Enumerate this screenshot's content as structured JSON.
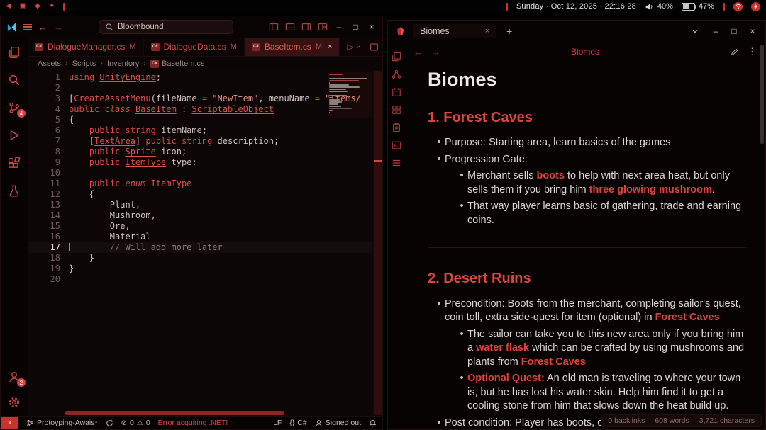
{
  "ui": {
    "bullet": "•",
    "crumb_sep": "›",
    "minimize": "–",
    "maximize": "□",
    "close": "×",
    "plus": "+",
    "back": "←",
    "forward": "→",
    "run": "▷",
    "more_h": "⋯",
    "more_v": "⋮",
    "braces": "{}",
    "err_glyph": "⊘",
    "warn_glyph": "⚠",
    "cs_badge": "C#",
    "tray_glyph": "◈"
  },
  "topbar": {
    "left_icons": [
      {
        "name": "nav-left-icon",
        "glyph": "◀"
      },
      {
        "name": "workspace-icon",
        "glyph": "▣"
      },
      {
        "name": "modules-icon",
        "glyph": "◆"
      },
      {
        "name": "sparkle-icon",
        "glyph": "✦"
      }
    ],
    "clock": "Sunday · Oct 12, 2025 · 22:16:28",
    "volume": "40%",
    "battery": "47%"
  },
  "vscode": {
    "search_value": "Bloombound",
    "activity": {
      "scm_badge": "4",
      "accounts_badge": "2"
    },
    "tabs": [
      {
        "label": "DialogueManager.cs",
        "badge": "M"
      },
      {
        "label": "DialogueData.cs",
        "badge": "M"
      },
      {
        "label": "BaseItem.cs",
        "badge": "M"
      }
    ],
    "breadcrumbs": [
      "Assets",
      "Scripts",
      "Inventory",
      "BaseItem.cs"
    ],
    "code": {
      "lines": [
        {
          "n": "1",
          "tk": [
            {
              "t": "using ",
              "c": "k"
            },
            {
              "t": "UnityEngine",
              "c": "tu"
            },
            {
              "t": ";",
              "c": "p"
            }
          ]
        },
        {
          "n": "2",
          "tk": []
        },
        {
          "n": "3",
          "tk": [
            {
              "t": "[",
              "c": "p"
            },
            {
              "t": "CreateAssetMenu",
              "c": "tu"
            },
            {
              "t": "(fileName ",
              "c": "p"
            },
            {
              "t": "= ",
              "c": "o"
            },
            {
              "t": "\"NewItem\"",
              "c": "s"
            },
            {
              "t": ", menuName ",
              "c": "p"
            },
            {
              "t": "= ",
              "c": "o"
            },
            {
              "t": "\"Items/",
              "c": "s"
            }
          ]
        },
        {
          "n": "4",
          "tk": [
            {
              "t": "public ",
              "c": "k"
            },
            {
              "t": "class ",
              "c": "ki"
            },
            {
              "t": "BaseItem",
              "c": "tu"
            },
            {
              "t": " : ",
              "c": "p"
            },
            {
              "t": "ScriptableObject",
              "c": "tu"
            }
          ]
        },
        {
          "n": "5",
          "tk": [
            {
              "t": "{",
              "c": "p"
            }
          ]
        },
        {
          "n": "6",
          "tk": [
            {
              "t": "    ",
              "c": "p"
            },
            {
              "t": "public string ",
              "c": "k"
            },
            {
              "t": "itemName;",
              "c": "p"
            }
          ]
        },
        {
          "n": "7",
          "tk": [
            {
              "t": "    [",
              "c": "p"
            },
            {
              "t": "TextArea",
              "c": "tu"
            },
            {
              "t": "] ",
              "c": "p"
            },
            {
              "t": "public string ",
              "c": "k"
            },
            {
              "t": "description;",
              "c": "p"
            }
          ]
        },
        {
          "n": "8",
          "tk": [
            {
              "t": "    ",
              "c": "p"
            },
            {
              "t": "public ",
              "c": "k"
            },
            {
              "t": "Sprite",
              "c": "tu"
            },
            {
              "t": " icon;",
              "c": "p"
            }
          ]
        },
        {
          "n": "9",
          "tk": [
            {
              "t": "    ",
              "c": "p"
            },
            {
              "t": "public ",
              "c": "k"
            },
            {
              "t": "ItemType",
              "c": "tu"
            },
            {
              "t": " type;",
              "c": "p"
            }
          ]
        },
        {
          "n": "10",
          "tk": []
        },
        {
          "n": "11",
          "tk": [
            {
              "t": "    ",
              "c": "p"
            },
            {
              "t": "public ",
              "c": "k"
            },
            {
              "t": "enum ",
              "c": "ki"
            },
            {
              "t": "ItemType",
              "c": "tu"
            }
          ]
        },
        {
          "n": "12",
          "tk": [
            {
              "t": "    {",
              "c": "p"
            }
          ]
        },
        {
          "n": "13",
          "tk": [
            {
              "t": "        Plant,",
              "c": "p"
            }
          ]
        },
        {
          "n": "14",
          "tk": [
            {
              "t": "        Mushroom,",
              "c": "p"
            }
          ]
        },
        {
          "n": "15",
          "tk": [
            {
              "t": "        Ore,",
              "c": "p"
            }
          ]
        },
        {
          "n": "16",
          "tk": [
            {
              "t": "        Material",
              "c": "p"
            }
          ]
        },
        {
          "n": "17",
          "cur": true,
          "caret": true,
          "tk": [
            {
              "t": "        // Will add more later",
              "c": "c"
            }
          ]
        },
        {
          "n": "18",
          "tk": [
            {
              "t": "    }",
              "c": "p"
            }
          ]
        },
        {
          "n": "19",
          "tk": [
            {
              "t": "}",
              "c": "p"
            }
          ]
        },
        {
          "n": "20",
          "tk": []
        }
      ]
    },
    "statusbar": {
      "branch": "Protoyping-Awais*",
      "errors": "0",
      "warnings": "0",
      "notice": "Error acquiring .NET!",
      "eol": "LF",
      "language": "C#",
      "account": "Signed out"
    }
  },
  "obsidian": {
    "tab_title": "Biomes",
    "path_title": "Biomes",
    "doc_title": "Biomes",
    "sections": [
      {
        "heading": "1. Forest Caves",
        "items": [
          {
            "level": 1,
            "segments": [
              {
                "t": "Purpose: Starting area, learn basics of the games"
              }
            ]
          },
          {
            "level": 1,
            "segments": [
              {
                "t": "Progression Gate:"
              }
            ]
          },
          {
            "level": 2,
            "segments": [
              {
                "t": "Merchant sells "
              },
              {
                "t": "boots",
                "s": "b"
              },
              {
                "t": " to help with next area heat, but only sells them if you bring him "
              },
              {
                "t": "three glowing mushroom",
                "s": "b"
              },
              {
                "t": "."
              }
            ]
          },
          {
            "level": 2,
            "segments": [
              {
                "t": "That way player learns basic of gathering, trade and earning coins."
              }
            ]
          }
        ]
      },
      {
        "heading": "2. Desert Ruins",
        "items": [
          {
            "level": 1,
            "segments": [
              {
                "t": "Precondition: Boots from the merchant, completing sailor's quest, coin toll, extra side-quest for item (optional) in "
              },
              {
                "t": "Forest Caves",
                "s": "b"
              }
            ]
          },
          {
            "level": 2,
            "segments": [
              {
                "t": "The sailor can take you to this new area only if you bring him a "
              },
              {
                "t": "water flask",
                "s": "b"
              },
              {
                "t": " which can be crafted by using mushrooms and plants from "
              },
              {
                "t": "Forest Caves",
                "s": "b"
              }
            ]
          },
          {
            "level": 2,
            "segments": [
              {
                "t": "Optional Quest:",
                "s": "b"
              },
              {
                "t": " An old man is traveling to where your town is, but he has lost his water skin. Help him find it to get a cooling stone from him that slows down the heat build up."
              }
            ]
          },
          {
            "level": 1,
            "segments": [
              {
                "t": "Post condition: Player has boots, can craft water source for"
              }
            ]
          }
        ]
      }
    ],
    "status": {
      "backlinks": "0 backlinks",
      "words": "608 words",
      "characters": "3,721 characters"
    }
  }
}
